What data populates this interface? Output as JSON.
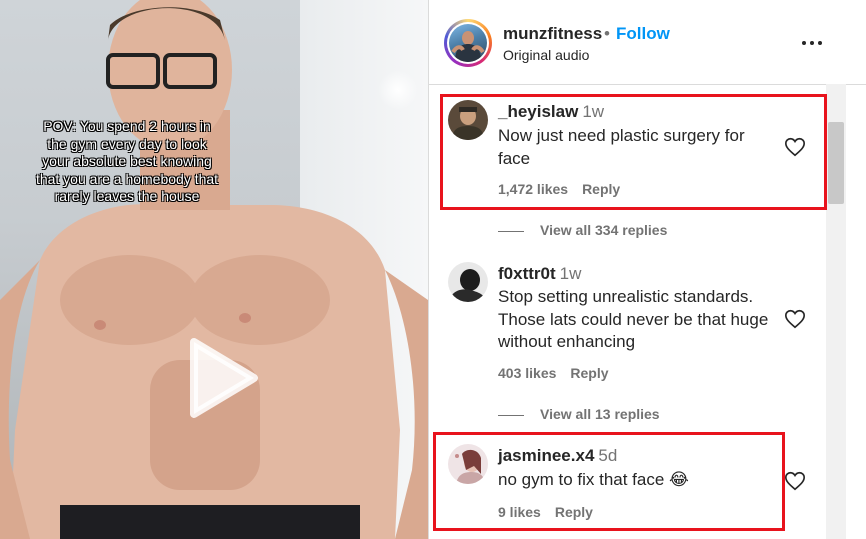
{
  "video": {
    "caption": "POV:  You spend 2 hours in the gym every day to look your absolute best knowing that you are a homebody that rarely leaves the house"
  },
  "header": {
    "username": "munzfitness",
    "separator": "•",
    "follow_label": "Follow",
    "audio_label": "Original audio"
  },
  "comments": [
    {
      "username": "_heyislaw",
      "time": "1w",
      "text": "Now just need plastic surgery for face",
      "likes": "1,472 likes",
      "reply_label": "Reply",
      "view_replies": "View all 334 replies"
    },
    {
      "username": "f0xttr0t",
      "time": "1w",
      "text": "Stop setting unrealistic standards. Those lats could never be that huge without enhancing",
      "likes": "403 likes",
      "reply_label": "Reply",
      "view_replies": "View all 13 replies"
    },
    {
      "username": "jasminee.x4",
      "time": "5d",
      "text": "no gym to fix that face 😂",
      "likes": "9 likes",
      "reply_label": "Reply"
    }
  ],
  "colors": {
    "accent": "#0095f6",
    "highlight": "#e8131d",
    "muted": "#737373"
  },
  "icons": [
    "play-icon",
    "more-options-icon",
    "heart-icon"
  ]
}
